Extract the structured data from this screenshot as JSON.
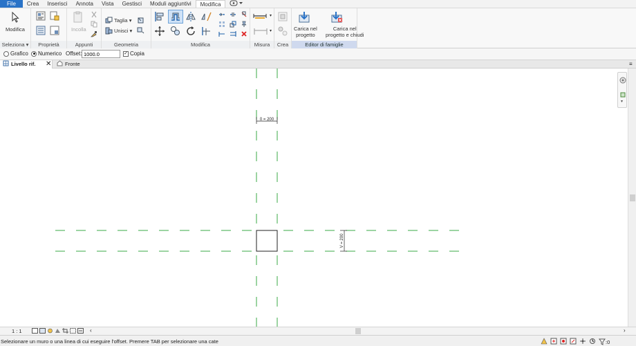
{
  "menu": {
    "tabs": [
      "File",
      "Crea",
      "Inserisci",
      "Annota",
      "Vista",
      "Gestisci",
      "Moduli aggiuntivi",
      "Modifica"
    ],
    "active": "Modifica"
  },
  "ribbon": {
    "select_panel": {
      "button": "Modifica",
      "label": "Seleziona ▾"
    },
    "properties_panel": {
      "label": "Proprietà"
    },
    "clipboard_panel": {
      "paste": "Incolla",
      "label": "Appunti"
    },
    "geometry_panel": {
      "cut": "Taglia",
      "join": "Unisci",
      "label": "Geometria"
    },
    "modify_panel": {
      "label": "Modifica"
    },
    "measure_panel": {
      "label": "Misura"
    },
    "create_panel": {
      "label": "Crea"
    },
    "family_editor_panel": {
      "load_line1": "Carica nel",
      "load_line2": "progetto",
      "load_close_line1": "Carica nel",
      "load_close_line2": "progetto e chiudi",
      "label": "Editor di famiglie"
    }
  },
  "options": {
    "graphic": "Grafico",
    "numeric": "Numerico",
    "offset_label": "Offset:",
    "offset_value": "1000.0",
    "copy": "Copia"
  },
  "views": {
    "active": "Livello rif.",
    "second": "Fronte"
  },
  "canvas": {
    "dim_top": "0 = 200",
    "dim_right": "V = 200"
  },
  "viewctrl": {
    "scale": "1 : 1"
  },
  "status": {
    "message": "Selezionare un muro o una linea di cui eseguire l'offset. Premere TAB per selezionare una cate",
    "filter_count": ":0"
  },
  "colors": {
    "file_tab": "#2a73c7",
    "ref_plane": "#3aa845",
    "accent_panel": "#cfd9ee"
  }
}
